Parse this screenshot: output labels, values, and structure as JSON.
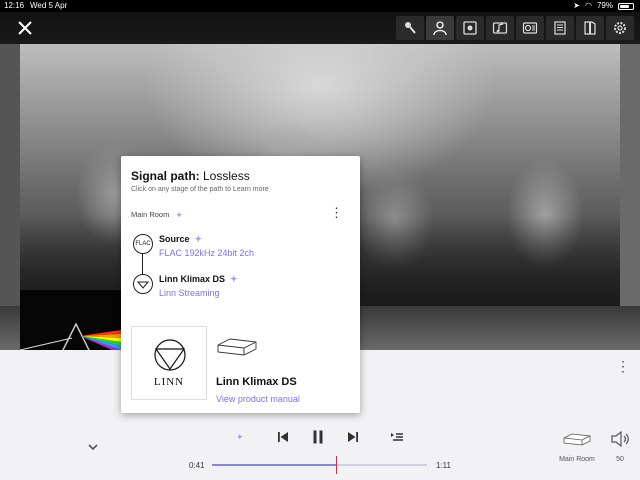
{
  "status_bar": {
    "time": "12:16",
    "date": "Wed 5 Apr",
    "battery": "79%",
    "battery_level": 0.79
  },
  "top_bar": {
    "close_icon": "close-icon",
    "icons": [
      "microphone-icon",
      "person-icon",
      "now-playing-icon",
      "music-note-icon",
      "album-list-icon",
      "lyrics-icon",
      "book-icon",
      "gear-icon"
    ],
    "active_index": 1
  },
  "signal_path": {
    "title_bold": "Signal path:",
    "title_rest": " Lossless",
    "hint": "Click on any stage of the path to Learn more",
    "room": "Main Room",
    "stages": [
      {
        "icon_text": "FLAC",
        "name": "Source",
        "detail": "FLAC 192kHz 24bit 2ch"
      },
      {
        "icon_text": "",
        "name": "Linn Klimax DS",
        "detail": "Linn Streaming"
      }
    ],
    "product": {
      "logo_text": "LINN",
      "name": "Linn Klimax DS",
      "manual_link": "View product manual"
    }
  },
  "player": {
    "elapsed": "0:41",
    "total": "1:11",
    "progress": 0.577,
    "room": "Main Room",
    "volume": "50"
  },
  "colors": {
    "accent": "#7d74d6",
    "playhead": "#d0304a",
    "lossless_diamond": "#a8a0e8"
  }
}
